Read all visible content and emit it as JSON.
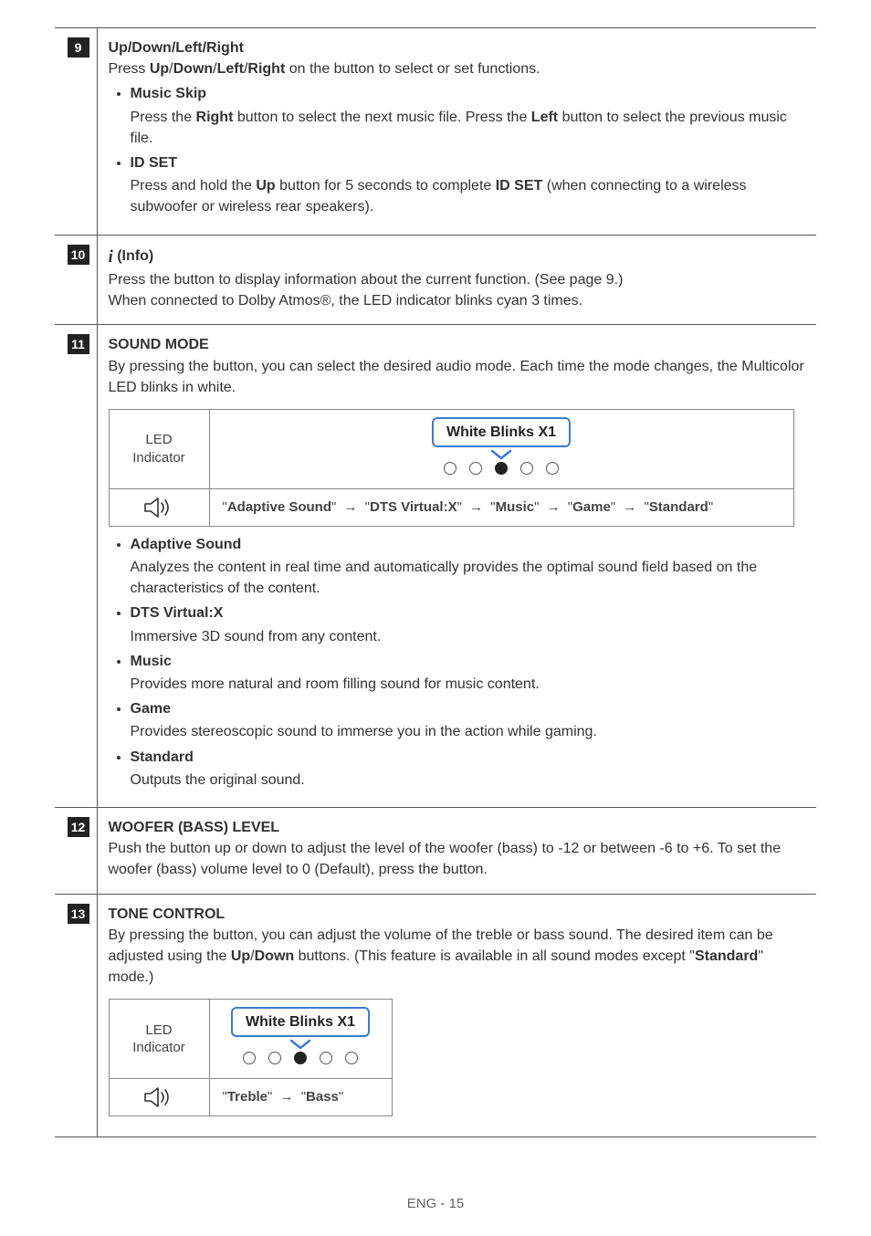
{
  "footer": "ENG - 15",
  "rows": {
    "r9": {
      "num": "9",
      "title": "Up/Down/Left/Right",
      "press_pre": "Press ",
      "up": "Up",
      "sep": "/",
      "down": "Down",
      "left": "Left",
      "right": "Right",
      "press_post": " on the button to select or set functions.",
      "music_skip_title": "Music Skip",
      "music_skip_body_1": "Press the ",
      "music_skip_right": "Right",
      "music_skip_body_2": " button to select the next music file. Press the ",
      "music_skip_left": "Left",
      "music_skip_body_3": " button to select the previous music file.",
      "idset_title": "ID SET",
      "idset_body_1": "Press and hold the ",
      "idset_up": "Up",
      "idset_body_2": " button for 5 seconds to complete ",
      "idset_bold": "ID SET",
      "idset_body_3": " (when connecting to a wireless subwoofer or wireless rear speakers)."
    },
    "r10": {
      "num": "10",
      "title": " (Info)",
      "body1": "Press the button to display information about the current function. (See page 9.)",
      "body2": "When connected to Dolby Atmos®, the LED indicator blinks cyan 3 times."
    },
    "r11": {
      "num": "11",
      "title": "SOUND MODE",
      "body": "By pressing the button, you can select the desired audio mode. Each time the mode changes, the Multicolor LED blinks in white.",
      "led_label_1": "LED",
      "led_label_2": "Indicator",
      "blink_label": "White Blinks X1",
      "seq_q": "\"",
      "seq": {
        "adaptive": "Adaptive Sound",
        "dts": "DTS Virtual:X",
        "music": "Music",
        "game": "Game",
        "standard": "Standard"
      },
      "arrow": "→",
      "modes": {
        "adaptive_t": "Adaptive Sound",
        "adaptive_b": "Analyzes the content in real time and automatically provides the optimal sound field based on the characteristics of the content.",
        "dts_t": "DTS Virtual:X",
        "dts_b": "Immersive 3D sound from any content.",
        "music_t": "Music",
        "music_b": "Provides more natural and room filling sound for music content.",
        "game_t": "Game",
        "game_b": "Provides stereoscopic sound to immerse you in the action while gaming.",
        "standard_t": "Standard",
        "standard_b": "Outputs the original sound."
      }
    },
    "r12": {
      "num": "12",
      "title": "WOOFER (BASS) LEVEL",
      "body": "Push the button up or down to adjust the level of the woofer (bass) to -12 or between -6 to +6. To set the woofer (bass) volume level to 0 (Default), press the button."
    },
    "r13": {
      "num": "13",
      "title": "TONE CONTROL",
      "body_1": "By pressing the button, you can adjust the volume of the treble or bass sound. The desired item can be adjusted using the ",
      "up": "Up",
      "sep": "/",
      "down": "Down",
      "body_2": " buttons. (This feature is available in all sound modes except \"",
      "standard": "Standard",
      "body_3": "\" mode.)",
      "led_label_1": "LED",
      "led_label_2": "Indicator",
      "blink_label": "White Blinks X1",
      "seq_q": "\"",
      "arrow": "→",
      "treble": "Treble",
      "bass": "Bass"
    }
  }
}
